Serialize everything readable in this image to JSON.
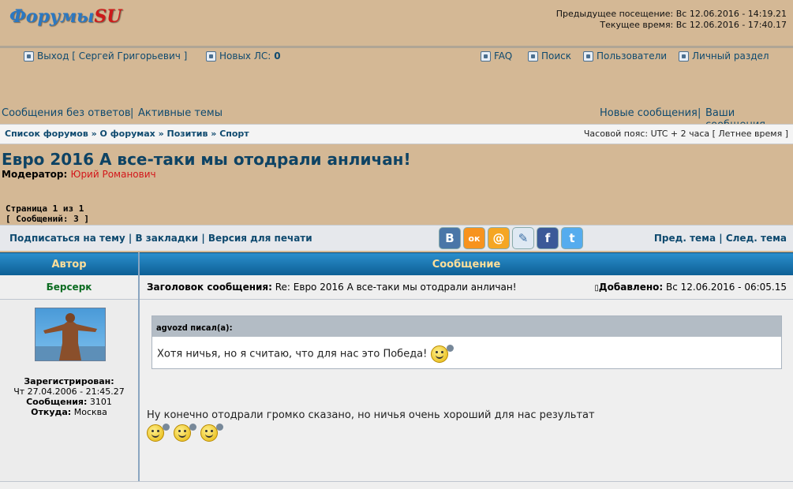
{
  "header": {
    "logo_main": "Форумы",
    "logo_su": "SU",
    "prev_visit": "Предыдущее посещение: Вс 12.06.2016 - 14:19.21",
    "current_time": "Текущее время: Вс 12.06.2016 - 17:40.17"
  },
  "nav": {
    "logout": "Выход [ Сергей Григорьевич ]",
    "new_pm_label": "Новых ЛС:",
    "new_pm_count": "0",
    "faq": "FAQ",
    "search": "Поиск",
    "users": "Пользователи",
    "profile": "Личный раздел"
  },
  "links": {
    "unanswered": "Сообщения без ответов",
    "active": "Активные темы",
    "new_posts": "Новые сообщения",
    "your_posts": "Ваши сообщения"
  },
  "breadcrumb": {
    "items": [
      "Список форумов",
      "О форумах",
      "Позитив",
      "Спорт"
    ],
    "timezone": "Часовой пояс: UTC + 2 часа [ Летнее время ]"
  },
  "topic": {
    "title": "Евро 2016 А все-таки мы отодрали анличан!",
    "moderator_label": "Модератор:",
    "moderator_name": "Юрий Романович",
    "page_info": "Страница 1 из 1",
    "post_count": "[ Сообщений: 3 ]"
  },
  "actions": {
    "subscribe": "Подписаться на тему",
    "bookmark": "В закладки",
    "print": "Версия для печати",
    "prev_topic": "Пред. тема",
    "next_topic": "След. тема",
    "share": [
      {
        "name": "vk-icon",
        "glyph": "В",
        "color": "#4a76a8"
      },
      {
        "name": "odnoklassniki-icon",
        "glyph": "ок",
        "color": "#f7931e"
      },
      {
        "name": "mailru-icon",
        "glyph": "@",
        "color": "#f5a623"
      },
      {
        "name": "livejournal-icon",
        "glyph": "✎",
        "color": "#dfe9f3"
      },
      {
        "name": "facebook-icon",
        "glyph": "f",
        "color": "#3b5998"
      },
      {
        "name": "twitter-icon",
        "glyph": "t",
        "color": "#55acee"
      }
    ]
  },
  "table": {
    "author_header": "Автор",
    "message_header": "Сообщение"
  },
  "post": {
    "author": "Берсерк",
    "subject_label": "Заголовок сообщения:",
    "subject": "Re: Евро 2016 А все-таки мы отодрали анличан!",
    "added_label": "Добавлено:",
    "added": "Вс 12.06.2016 - 06:05.15",
    "registered_label": "Зарегистрирован:",
    "registered": "Чт 27.04.2006 - 21:45.27",
    "posts_label": "Сообщения:",
    "posts": "3101",
    "from_label": "Откуда:",
    "from": "Москва",
    "quote_author": "agvozd писал(а):",
    "quote_text": "Хотя ничья, но я считаю, что для нас это Победа!",
    "message": "Ну конечно отодрали громко сказано, но ничья очень хороший для нас результат"
  },
  "colors": {
    "page_bg": "#d4b895",
    "link": "#0f4a6f",
    "header_blue": "#1673ad",
    "moderator": "#d3161a",
    "author": "#0b6b20"
  }
}
